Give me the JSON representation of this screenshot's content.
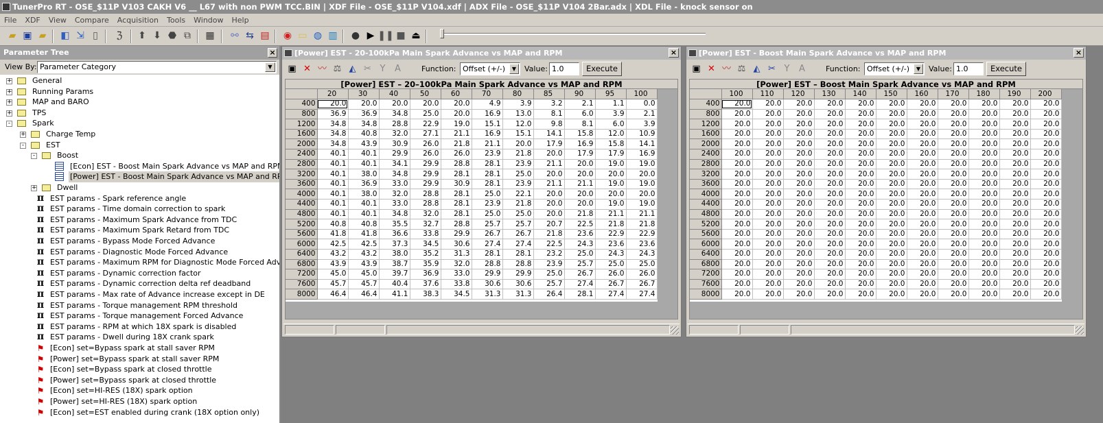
{
  "app_title": "TunerPro RT - OSE_$11P V103 CAKH V6 __ L67 with non PWM TCC.BIN | XDF File - OSE_$11P V104.xdf | ADX File - OSE_$11P V104 2Bar.adx | XDL File - knock sensor on",
  "menu": [
    "File",
    "XDF",
    "View",
    "Compare",
    "Acquisition",
    "Tools",
    "Window",
    "Help"
  ],
  "parameter_tree": {
    "title": "Parameter Tree",
    "view_by_label": "View By:",
    "view_by_value": "Parameter Category",
    "nodes": [
      {
        "label": "General",
        "level": 0,
        "type": "folder",
        "expander": "+"
      },
      {
        "label": "Running Params",
        "level": 0,
        "type": "folder",
        "expander": "+"
      },
      {
        "label": "MAP and BARO",
        "level": 0,
        "type": "folder",
        "expander": "+"
      },
      {
        "label": "TPS",
        "level": 0,
        "type": "folder",
        "expander": "+"
      },
      {
        "label": "Spark",
        "level": 0,
        "type": "folder-open",
        "expander": "-"
      },
      {
        "label": "Charge Temp",
        "level": 1,
        "type": "folder",
        "expander": "+"
      },
      {
        "label": "EST",
        "level": 1,
        "type": "folder-open",
        "expander": "-"
      },
      {
        "label": "Boost",
        "level": 2,
        "type": "folder-open",
        "expander": "-"
      },
      {
        "label": "[Econ] EST - Boost Main Spark Advance vs MAP and RPM",
        "level": 3,
        "type": "table"
      },
      {
        "label": "[Power] EST - Boost Main Spark Advance vs MAP and RPM",
        "level": 3,
        "type": "table",
        "selected": true
      },
      {
        "label": "Dwell",
        "level": 2,
        "type": "folder",
        "expander": "+"
      },
      {
        "label": "EST params - Spark reference angle",
        "level": 2,
        "type": "constant"
      },
      {
        "label": "EST params - Time domain correction to spark",
        "level": 2,
        "type": "constant"
      },
      {
        "label": "EST params - Maximum Spark Advance from TDC",
        "level": 2,
        "type": "constant"
      },
      {
        "label": "EST params - Maximum Spark Retard from TDC",
        "level": 2,
        "type": "constant"
      },
      {
        "label": "EST params - Bypass Mode Forced Advance",
        "level": 2,
        "type": "constant"
      },
      {
        "label": "EST params - Diagnostic Mode Forced Advance",
        "level": 2,
        "type": "constant"
      },
      {
        "label": "EST params - Maximum RPM for Diagnostic Mode Forced Advance",
        "level": 2,
        "type": "constant"
      },
      {
        "label": "EST params - Dynamic correction factor",
        "level": 2,
        "type": "constant"
      },
      {
        "label": "EST params - Dynamic correction delta ref deadband",
        "level": 2,
        "type": "constant"
      },
      {
        "label": "EST params - Max rate of Advance increase except in DE",
        "level": 2,
        "type": "constant"
      },
      {
        "label": "EST params - Torque management RPM threshold",
        "level": 2,
        "type": "constant"
      },
      {
        "label": "EST params - Torque management Forced Advance",
        "level": 2,
        "type": "constant"
      },
      {
        "label": "EST params - RPM at which 18X spark is disabled",
        "level": 2,
        "type": "constant"
      },
      {
        "label": "EST params - Dwell during 18X crank spark",
        "level": 2,
        "type": "constant"
      },
      {
        "label": "[Econ] set=Bypass spark at stall saver RPM",
        "level": 2,
        "type": "flag"
      },
      {
        "label": "[Power] set=Bypass spark at stall saver RPM",
        "level": 2,
        "type": "flag"
      },
      {
        "label": "[Econ] set=Bypass spark at closed throttle",
        "level": 2,
        "type": "flag"
      },
      {
        "label": "[Power] set=Bypass spark at closed throttle",
        "level": 2,
        "type": "flag"
      },
      {
        "label": "[Econ] set=HI-RES (18X) spark option",
        "level": 2,
        "type": "flag"
      },
      {
        "label": "[Power] set=HI-RES (18X) spark option",
        "level": 2,
        "type": "flag"
      },
      {
        "label": "[Econ] set=EST enabled during crank  (18X option only)",
        "level": 2,
        "type": "flag"
      }
    ]
  },
  "windows": [
    {
      "title": "[Power] EST - 20-100kPa Main Spark Advance vs MAP and RPM",
      "caption": "[Power] EST – 20–100kPa Main Spark Advance vs MAP and RPM",
      "function_label": "Function:",
      "function_value": "Offset (+/-)",
      "value_label": "Value:",
      "value": "1.0",
      "execute_label": "Execute",
      "columns": [
        "20",
        "30",
        "40",
        "50",
        "60",
        "70",
        "80",
        "85",
        "90",
        "95",
        "100"
      ],
      "rows": [
        "400",
        "800",
        "1200",
        "1600",
        "2000",
        "2400",
        "2800",
        "3200",
        "3600",
        "4000",
        "4400",
        "4800",
        "5200",
        "5600",
        "6000",
        "6400",
        "6800",
        "7200",
        "7600",
        "8000"
      ],
      "cells": [
        [
          "20.0",
          "20.0",
          "20.0",
          "20.0",
          "20.0",
          "4.9",
          "3.9",
          "3.2",
          "2.1",
          "1.1",
          "0.0"
        ],
        [
          "36.9",
          "36.9",
          "34.8",
          "25.0",
          "20.0",
          "16.9",
          "13.0",
          "8.1",
          "6.0",
          "3.9",
          "2.1"
        ],
        [
          "34.8",
          "34.8",
          "28.8",
          "22.9",
          "19.0",
          "15.1",
          "12.0",
          "9.8",
          "8.1",
          "6.0",
          "3.9"
        ],
        [
          "34.8",
          "40.8",
          "32.0",
          "27.1",
          "21.1",
          "16.9",
          "15.1",
          "14.1",
          "15.8",
          "12.0",
          "10.9"
        ],
        [
          "34.8",
          "43.9",
          "30.9",
          "26.0",
          "21.8",
          "21.1",
          "20.0",
          "17.9",
          "16.9",
          "15.8",
          "14.1"
        ],
        [
          "40.1",
          "40.1",
          "29.9",
          "26.0",
          "26.0",
          "23.9",
          "21.8",
          "20.0",
          "17.9",
          "17.9",
          "16.9"
        ],
        [
          "40.1",
          "40.1",
          "34.1",
          "29.9",
          "28.8",
          "28.1",
          "23.9",
          "21.1",
          "20.0",
          "19.0",
          "19.0"
        ],
        [
          "40.1",
          "38.0",
          "34.8",
          "29.9",
          "28.1",
          "28.1",
          "25.0",
          "20.0",
          "20.0",
          "20.0",
          "20.0"
        ],
        [
          "40.1",
          "36.9",
          "33.0",
          "29.9",
          "30.9",
          "28.1",
          "23.9",
          "21.1",
          "21.1",
          "19.0",
          "19.0"
        ],
        [
          "40.1",
          "38.0",
          "32.0",
          "28.8",
          "28.1",
          "25.0",
          "22.1",
          "20.0",
          "20.0",
          "20.0",
          "20.0"
        ],
        [
          "40.1",
          "40.1",
          "33.0",
          "28.8",
          "28.1",
          "23.9",
          "21.8",
          "20.0",
          "20.0",
          "19.0",
          "19.0"
        ],
        [
          "40.1",
          "40.1",
          "34.8",
          "32.0",
          "28.1",
          "25.0",
          "25.0",
          "20.0",
          "21.8",
          "21.1",
          "21.1"
        ],
        [
          "40.8",
          "40.8",
          "35.5",
          "32.7",
          "28.8",
          "25.7",
          "25.7",
          "20.7",
          "22.5",
          "21.8",
          "21.8"
        ],
        [
          "41.8",
          "41.8",
          "36.6",
          "33.8",
          "29.9",
          "26.7",
          "26.7",
          "21.8",
          "23.6",
          "22.9",
          "22.9"
        ],
        [
          "42.5",
          "42.5",
          "37.3",
          "34.5",
          "30.6",
          "27.4",
          "27.4",
          "22.5",
          "24.3",
          "23.6",
          "23.6"
        ],
        [
          "43.2",
          "43.2",
          "38.0",
          "35.2",
          "31.3",
          "28.1",
          "28.1",
          "23.2",
          "25.0",
          "24.3",
          "24.3"
        ],
        [
          "43.9",
          "43.9",
          "38.7",
          "35.9",
          "32.0",
          "28.8",
          "28.8",
          "23.9",
          "25.7",
          "25.0",
          "25.0"
        ],
        [
          "45.0",
          "45.0",
          "39.7",
          "36.9",
          "33.0",
          "29.9",
          "29.9",
          "25.0",
          "26.7",
          "26.0",
          "26.0"
        ],
        [
          "45.7",
          "45.7",
          "40.4",
          "37.6",
          "33.8",
          "30.6",
          "30.6",
          "25.7",
          "27.4",
          "26.7",
          "26.7"
        ],
        [
          "46.4",
          "46.4",
          "41.1",
          "38.3",
          "34.5",
          "31.3",
          "31.3",
          "26.4",
          "28.1",
          "27.4",
          "27.4"
        ]
      ]
    },
    {
      "title": "[Power] EST - Boost Main Spark Advance vs MAP and RPM",
      "caption": "[Power] EST – Boost Main Spark Advance vs MAP and RPM",
      "function_label": "Function:",
      "function_value": "Offset (+/-)",
      "value_label": "Value:",
      "value": "1.0",
      "execute_label": "Execute",
      "columns": [
        "100",
        "110",
        "120",
        "130",
        "140",
        "150",
        "160",
        "170",
        "180",
        "190",
        "200"
      ],
      "rows": [
        "400",
        "800",
        "1200",
        "1600",
        "2000",
        "2400",
        "2800",
        "3200",
        "3600",
        "4000",
        "4400",
        "4800",
        "5200",
        "5600",
        "6000",
        "6400",
        "6800",
        "7200",
        "7600",
        "8000"
      ],
      "fill_value": "20.0"
    }
  ]
}
